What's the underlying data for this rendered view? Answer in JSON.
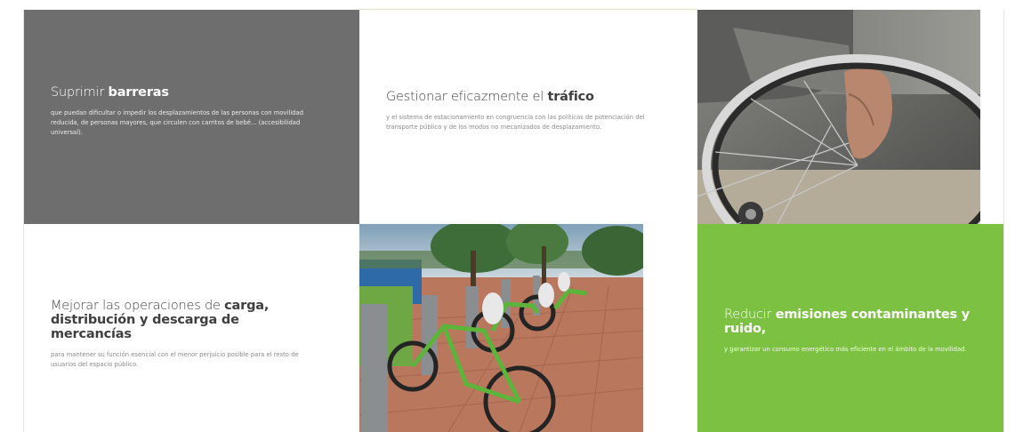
{
  "tiles": {
    "barreras": {
      "title_light": "Suprimir ",
      "title_bold": "barreras",
      "body": "que puedan dificultar o impedir los desplazamientos de las personas con movilidad reducida, de personas mayores, que circulen con carritos de bebé... (accesibilidad universal)."
    },
    "trafico": {
      "title_light": "Gestionar eficazmente el ",
      "title_bold": "tráfico",
      "body": "y el sistema de estacionamiento en congruencia con las políticas de potenciación del transporte público y de los modos no mecanizados de desplazamiento."
    },
    "mercancias": {
      "title_light": "Mejorar las operaciones de ",
      "title_bold": "carga, distribución y descarga de mercancías",
      "body": "para mantener su función esencial con el menor perjuicio posible para el resto de usuarios del espacio público."
    },
    "emisiones": {
      "title_light": "Reducir ",
      "title_bold": "emisiones contaminantes y ruido,",
      "body": "y garantizar un consumo energético más eficiente en el ámbito de la movilidad."
    }
  },
  "colors": {
    "dark_tile": "#6e6e6e",
    "green_tile": "#7cc142",
    "page_background": "#ffffff"
  },
  "images": {
    "wheelchair": "wheelchair-photo",
    "bikes": "bike-sharing-photo"
  }
}
